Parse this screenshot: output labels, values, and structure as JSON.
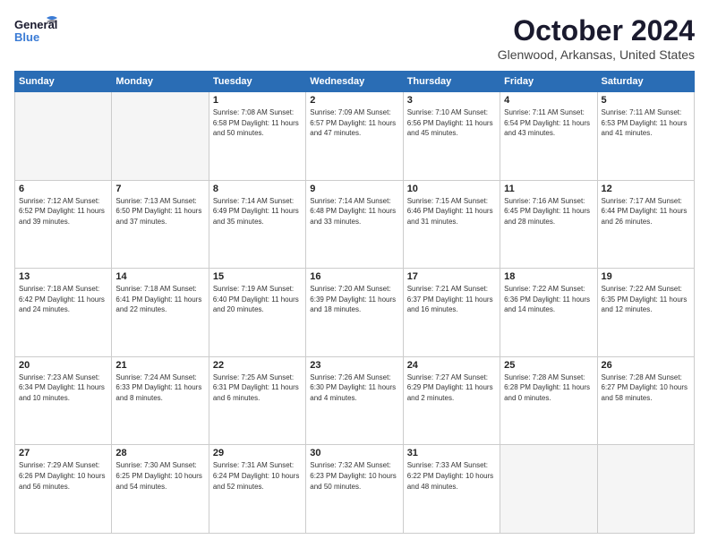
{
  "header": {
    "logo_line1": "General",
    "logo_line2": "Blue",
    "month": "October 2024",
    "location": "Glenwood, Arkansas, United States"
  },
  "days_of_week": [
    "Sunday",
    "Monday",
    "Tuesday",
    "Wednesday",
    "Thursday",
    "Friday",
    "Saturday"
  ],
  "weeks": [
    [
      {
        "day": "",
        "info": ""
      },
      {
        "day": "",
        "info": ""
      },
      {
        "day": "1",
        "info": "Sunrise: 7:08 AM\nSunset: 6:58 PM\nDaylight: 11 hours\nand 50 minutes."
      },
      {
        "day": "2",
        "info": "Sunrise: 7:09 AM\nSunset: 6:57 PM\nDaylight: 11 hours\nand 47 minutes."
      },
      {
        "day": "3",
        "info": "Sunrise: 7:10 AM\nSunset: 6:56 PM\nDaylight: 11 hours\nand 45 minutes."
      },
      {
        "day": "4",
        "info": "Sunrise: 7:11 AM\nSunset: 6:54 PM\nDaylight: 11 hours\nand 43 minutes."
      },
      {
        "day": "5",
        "info": "Sunrise: 7:11 AM\nSunset: 6:53 PM\nDaylight: 11 hours\nand 41 minutes."
      }
    ],
    [
      {
        "day": "6",
        "info": "Sunrise: 7:12 AM\nSunset: 6:52 PM\nDaylight: 11 hours\nand 39 minutes."
      },
      {
        "day": "7",
        "info": "Sunrise: 7:13 AM\nSunset: 6:50 PM\nDaylight: 11 hours\nand 37 minutes."
      },
      {
        "day": "8",
        "info": "Sunrise: 7:14 AM\nSunset: 6:49 PM\nDaylight: 11 hours\nand 35 minutes."
      },
      {
        "day": "9",
        "info": "Sunrise: 7:14 AM\nSunset: 6:48 PM\nDaylight: 11 hours\nand 33 minutes."
      },
      {
        "day": "10",
        "info": "Sunrise: 7:15 AM\nSunset: 6:46 PM\nDaylight: 11 hours\nand 31 minutes."
      },
      {
        "day": "11",
        "info": "Sunrise: 7:16 AM\nSunset: 6:45 PM\nDaylight: 11 hours\nand 28 minutes."
      },
      {
        "day": "12",
        "info": "Sunrise: 7:17 AM\nSunset: 6:44 PM\nDaylight: 11 hours\nand 26 minutes."
      }
    ],
    [
      {
        "day": "13",
        "info": "Sunrise: 7:18 AM\nSunset: 6:42 PM\nDaylight: 11 hours\nand 24 minutes."
      },
      {
        "day": "14",
        "info": "Sunrise: 7:18 AM\nSunset: 6:41 PM\nDaylight: 11 hours\nand 22 minutes."
      },
      {
        "day": "15",
        "info": "Sunrise: 7:19 AM\nSunset: 6:40 PM\nDaylight: 11 hours\nand 20 minutes."
      },
      {
        "day": "16",
        "info": "Sunrise: 7:20 AM\nSunset: 6:39 PM\nDaylight: 11 hours\nand 18 minutes."
      },
      {
        "day": "17",
        "info": "Sunrise: 7:21 AM\nSunset: 6:37 PM\nDaylight: 11 hours\nand 16 minutes."
      },
      {
        "day": "18",
        "info": "Sunrise: 7:22 AM\nSunset: 6:36 PM\nDaylight: 11 hours\nand 14 minutes."
      },
      {
        "day": "19",
        "info": "Sunrise: 7:22 AM\nSunset: 6:35 PM\nDaylight: 11 hours\nand 12 minutes."
      }
    ],
    [
      {
        "day": "20",
        "info": "Sunrise: 7:23 AM\nSunset: 6:34 PM\nDaylight: 11 hours\nand 10 minutes."
      },
      {
        "day": "21",
        "info": "Sunrise: 7:24 AM\nSunset: 6:33 PM\nDaylight: 11 hours\nand 8 minutes."
      },
      {
        "day": "22",
        "info": "Sunrise: 7:25 AM\nSunset: 6:31 PM\nDaylight: 11 hours\nand 6 minutes."
      },
      {
        "day": "23",
        "info": "Sunrise: 7:26 AM\nSunset: 6:30 PM\nDaylight: 11 hours\nand 4 minutes."
      },
      {
        "day": "24",
        "info": "Sunrise: 7:27 AM\nSunset: 6:29 PM\nDaylight: 11 hours\nand 2 minutes."
      },
      {
        "day": "25",
        "info": "Sunrise: 7:28 AM\nSunset: 6:28 PM\nDaylight: 11 hours\nand 0 minutes."
      },
      {
        "day": "26",
        "info": "Sunrise: 7:28 AM\nSunset: 6:27 PM\nDaylight: 10 hours\nand 58 minutes."
      }
    ],
    [
      {
        "day": "27",
        "info": "Sunrise: 7:29 AM\nSunset: 6:26 PM\nDaylight: 10 hours\nand 56 minutes."
      },
      {
        "day": "28",
        "info": "Sunrise: 7:30 AM\nSunset: 6:25 PM\nDaylight: 10 hours\nand 54 minutes."
      },
      {
        "day": "29",
        "info": "Sunrise: 7:31 AM\nSunset: 6:24 PM\nDaylight: 10 hours\nand 52 minutes."
      },
      {
        "day": "30",
        "info": "Sunrise: 7:32 AM\nSunset: 6:23 PM\nDaylight: 10 hours\nand 50 minutes."
      },
      {
        "day": "31",
        "info": "Sunrise: 7:33 AM\nSunset: 6:22 PM\nDaylight: 10 hours\nand 48 minutes."
      },
      {
        "day": "",
        "info": ""
      },
      {
        "day": "",
        "info": ""
      }
    ]
  ]
}
